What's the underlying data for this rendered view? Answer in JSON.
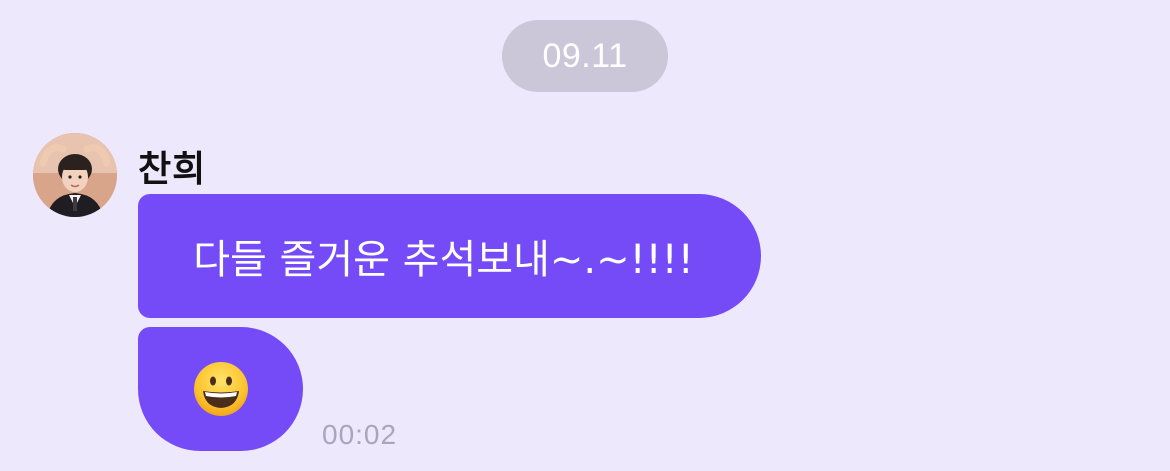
{
  "chat": {
    "date_divider": "09.11",
    "message": {
      "sender": "찬희",
      "text": "다들 즐거운 추석보내~.~!!!!",
      "emoji_name": "grinning-face-emoji",
      "time": "00:02"
    }
  },
  "colors": {
    "background": "#ede8fb",
    "bubble": "#754bf7",
    "date_pill": "#cbc7d8",
    "timestamp": "#aaa5bd"
  }
}
